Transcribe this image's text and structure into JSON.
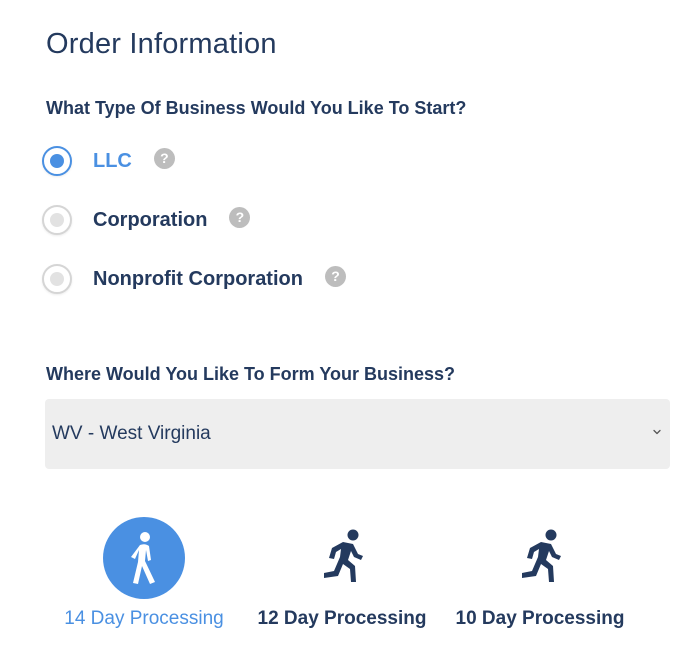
{
  "header": {
    "title": "Order Information"
  },
  "business_type": {
    "question": "What Type Of Business Would You Like To Start?",
    "help_glyph": "?",
    "options": [
      {
        "label": "LLC",
        "selected": true
      },
      {
        "label": "Corporation",
        "selected": false
      },
      {
        "label": "Nonprofit Corporation",
        "selected": false
      }
    ]
  },
  "state": {
    "question": "Where Would You Like To Form Your Business?",
    "selected_value": "WV - West Virginia",
    "chevron_icon": "chevron-down-icon"
  },
  "processing": {
    "options": [
      {
        "label": "14 Day Processing",
        "icon": "walking-person-icon",
        "selected": true
      },
      {
        "label": "12 Day Processing",
        "icon": "running-person-icon",
        "selected": false
      },
      {
        "label": "10 Day Processing",
        "icon": "running-person-icon",
        "selected": false
      }
    ]
  },
  "colors": {
    "accent": "#4a90e2",
    "text": "#243a5e",
    "help_icon": "#bdbdbd",
    "select_bg": "#eeeeee"
  }
}
